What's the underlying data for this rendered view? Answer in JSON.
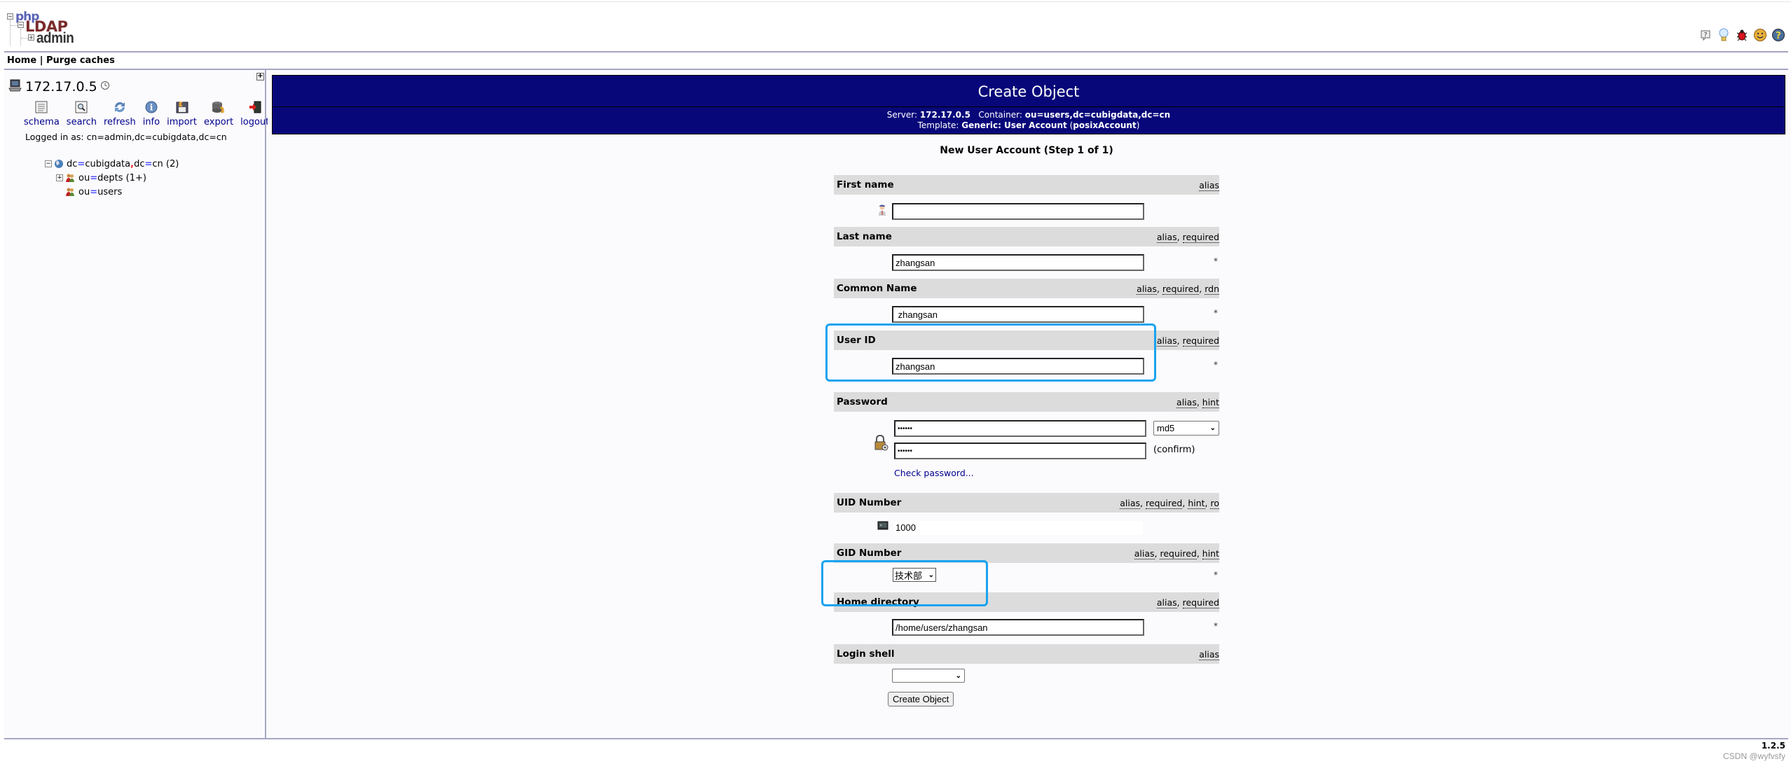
{
  "app": {
    "logo": {
      "php": "php",
      "ldap": "LDAP",
      "admin": "admin"
    },
    "header_icons": [
      "help-small-icon",
      "lightbulb-icon",
      "bug-icon",
      "smiley-icon",
      "help-icon"
    ],
    "nav": {
      "home": "Home",
      "separator": "|",
      "purge": "Purge caches"
    },
    "version": "1.2.5",
    "watermark": "CSDN @wyfvsfy"
  },
  "sidebar": {
    "expand": "+",
    "server": "172.17.0.5",
    "toolbar": [
      {
        "label": "schema",
        "icon": "schema-icon"
      },
      {
        "label": "search",
        "icon": "search-icon"
      },
      {
        "label": "refresh",
        "icon": "refresh-icon"
      },
      {
        "label": "info",
        "icon": "info-icon"
      },
      {
        "label": "import",
        "icon": "import-icon"
      },
      {
        "label": "export",
        "icon": "export-icon"
      },
      {
        "label": "logout",
        "icon": "logout-icon"
      }
    ],
    "logged_in_as": "Logged in as: cn=admin,dc=cubigdata,dc=cn",
    "tree": {
      "root": {
        "a": "dc",
        "b": "cubigdata",
        "c": "dc",
        "d": "cn",
        "count": "(2)",
        "expanded": true
      },
      "children": [
        {
          "attr": "ou",
          "val": "depts",
          "count": "(1+)",
          "expandable": true
        },
        {
          "attr": "ou",
          "val": "users",
          "count": "",
          "expandable": false
        }
      ]
    }
  },
  "main": {
    "title": "Create Object",
    "server_label": "Server:",
    "server": "172.17.0.5",
    "container_label": "Container:",
    "container": "ou=users,dc=cubigdata,dc=cn",
    "template_label": "Template:",
    "template": "Generic: User Account",
    "template_class_open": "(",
    "template_class": "posixAccount",
    "template_class_close": ")",
    "step_title": "New User Account (Step 1 of 1)",
    "fields": {
      "first_name": {
        "label": "First name",
        "flags": [
          "alias"
        ],
        "value": "",
        "required": false
      },
      "last_name": {
        "label": "Last name",
        "flags": [
          "alias",
          "required"
        ],
        "value": "zhangsan",
        "required": true
      },
      "common_name": {
        "label": "Common Name",
        "flags": [
          "alias",
          "required",
          "rdn"
        ],
        "value": " zhangsan",
        "required": true
      },
      "user_id": {
        "label": "User ID",
        "flags": [
          "alias",
          "required"
        ],
        "value": "zhangsan",
        "required": true
      },
      "password": {
        "label": "Password",
        "flags": [
          "alias",
          "hint"
        ],
        "value": "••••••",
        "confirm_value": "••••••",
        "hash": "md5",
        "confirm_label": "(confirm)",
        "check_link": "Check password..."
      },
      "uid_number": {
        "label": "UID Number",
        "flags": [
          "alias",
          "required",
          "hint",
          "ro"
        ],
        "value": "1000"
      },
      "gid_number": {
        "label": "GID Number",
        "flags": [
          "alias",
          "required",
          "hint"
        ],
        "value": "技术部",
        "required": true
      },
      "home_directory": {
        "label": "Home directory",
        "flags": [
          "alias",
          "required"
        ],
        "value": "/home/users/zhangsan",
        "required": true
      },
      "login_shell": {
        "label": "Login shell",
        "flags": [
          "alias"
        ],
        "value": ""
      }
    },
    "required_marker": "*",
    "create_button": "Create Object"
  }
}
